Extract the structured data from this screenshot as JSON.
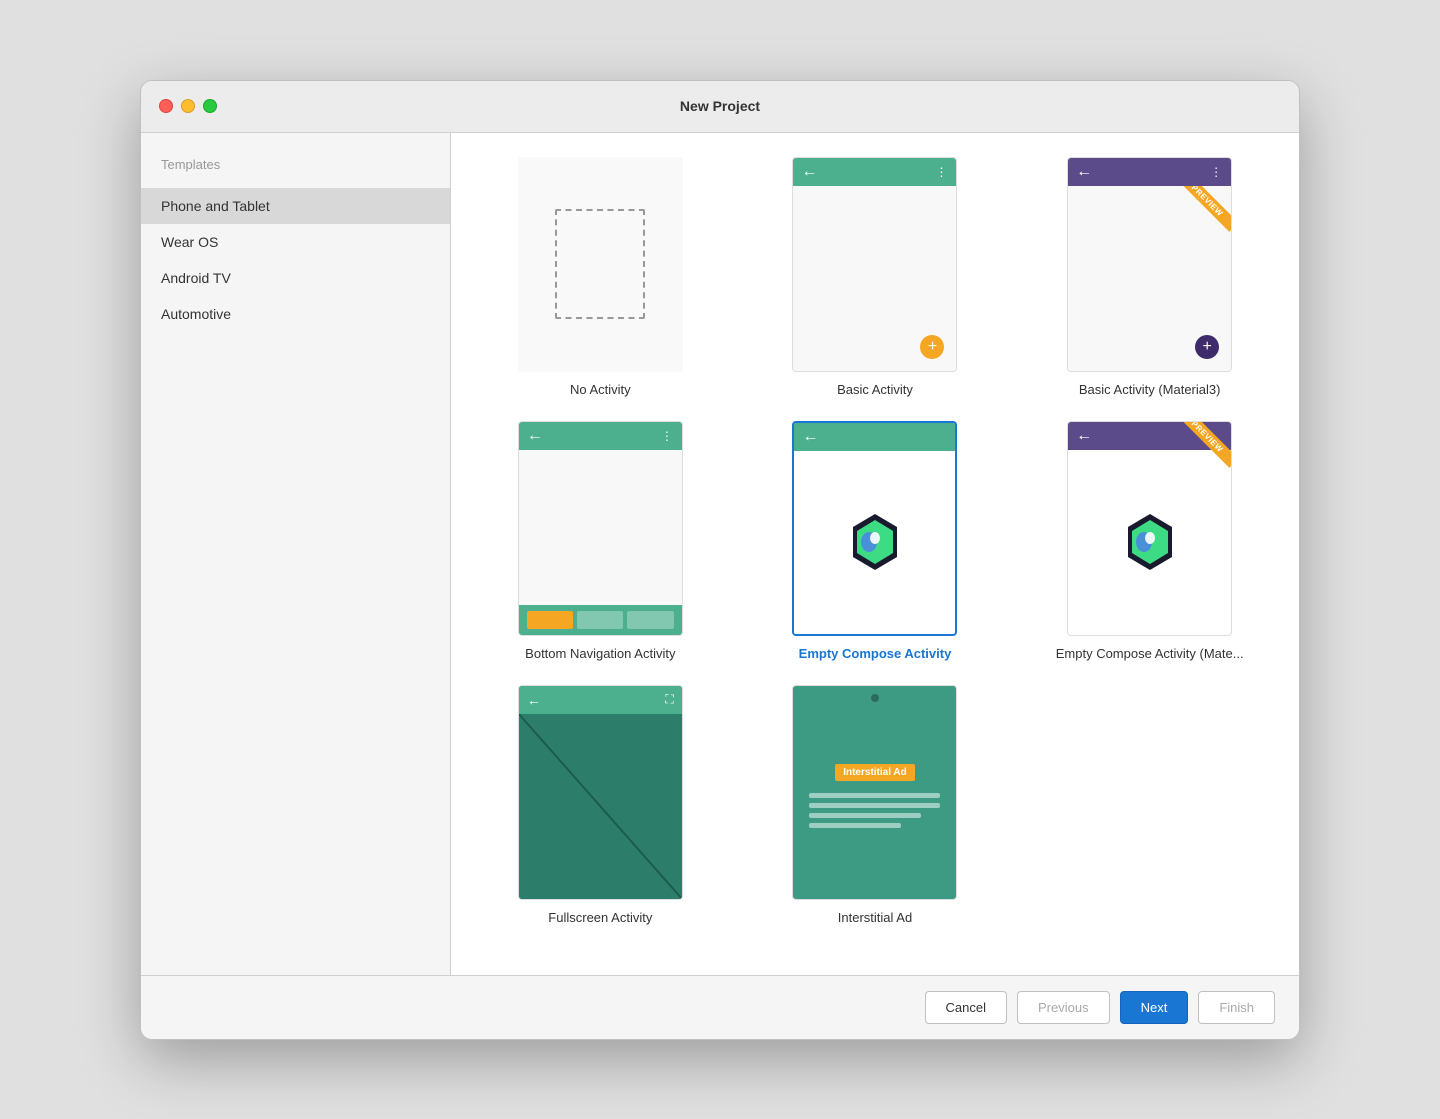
{
  "window": {
    "title": "New Project"
  },
  "sidebar": {
    "section_label": "Templates",
    "items": [
      {
        "id": "phone-tablet",
        "label": "Phone and Tablet",
        "active": true
      },
      {
        "id": "wear-os",
        "label": "Wear OS",
        "active": false
      },
      {
        "id": "android-tv",
        "label": "Android TV",
        "active": false
      },
      {
        "id": "automotive",
        "label": "Automotive",
        "active": false
      }
    ]
  },
  "templates": [
    {
      "id": "no-activity",
      "label": "No Activity",
      "selected": false
    },
    {
      "id": "basic-activity",
      "label": "Basic Activity",
      "selected": false
    },
    {
      "id": "basic-activity-material3",
      "label": "Basic Activity (Material3)",
      "selected": false
    },
    {
      "id": "bottom-navigation",
      "label": "Bottom Navigation Activity",
      "selected": false
    },
    {
      "id": "empty-compose",
      "label": "Empty Compose Activity",
      "selected": true
    },
    {
      "id": "empty-compose-material",
      "label": "Empty Compose Activity (Mate...",
      "selected": false
    },
    {
      "id": "fullscreen",
      "label": "Fullscreen Activity",
      "selected": false
    },
    {
      "id": "interstitial-ad",
      "label": "Interstitial Ad",
      "selected": false
    }
  ],
  "buttons": {
    "cancel": "Cancel",
    "previous": "Previous",
    "next": "Next",
    "finish": "Finish"
  },
  "preview_badge": "PREVIEW",
  "interstitial_ad_label": "Interstitial Ad"
}
